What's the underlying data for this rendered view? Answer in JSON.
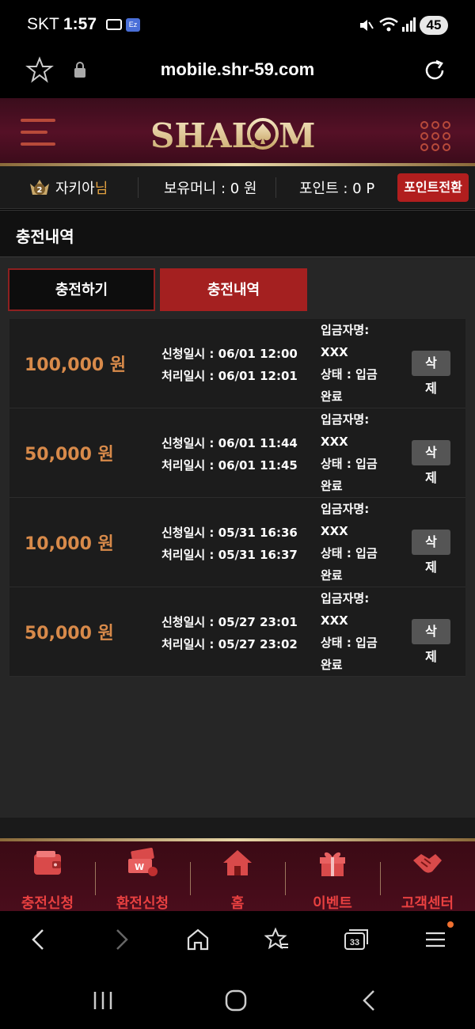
{
  "status_bar": {
    "carrier": "SKT",
    "time": "1:57",
    "battery": "45",
    "ez_label": "Ez"
  },
  "browser": {
    "url": "mobile.shr-59.com",
    "tab_count": "33"
  },
  "header": {
    "logo_text": "SHALOM"
  },
  "user_bar": {
    "level": "2",
    "username": "자키아",
    "honorific": "님",
    "money": "보유머니 : 0 원",
    "points": "포인트 : 0 P",
    "convert_label": "포인트전환"
  },
  "page": {
    "title": "충전내역"
  },
  "tabs": [
    {
      "label": "충전하기",
      "active": false
    },
    {
      "label": "충전내역",
      "active": true
    }
  ],
  "history": [
    {
      "amount": "100,000 원",
      "requested": "신청일시 : 06/01 12:00",
      "processed": "처리일시 : 06/01 12:01",
      "depositor_label": "입금자명:",
      "depositor": "XXX",
      "status_label": "상태 : 입금",
      "status_value": "완료",
      "delete_1": "삭",
      "delete_2": "제"
    },
    {
      "amount": "50,000 원",
      "requested": "신청일시 : 06/01 11:44",
      "processed": "처리일시 : 06/01 11:45",
      "depositor_label": "입금자명:",
      "depositor": "XXX",
      "status_label": "상태 : 입금",
      "status_value": "완료",
      "delete_1": "삭",
      "delete_2": "제"
    },
    {
      "amount": "10,000 원",
      "requested": "신청일시 : 05/31 16:36",
      "processed": "처리일시 : 05/31 16:37",
      "depositor_label": "입금자명:",
      "depositor": "XXX",
      "status_label": "상태 : 입금",
      "status_value": "완료",
      "delete_1": "삭",
      "delete_2": "제"
    },
    {
      "amount": "50,000 원",
      "requested": "신청일시 : 05/27 23:01",
      "processed": "처리일시 : 05/27 23:02",
      "depositor_label": "입금자명:",
      "depositor": "XXX",
      "status_label": "상태 : 입금",
      "status_value": "완료",
      "delete_1": "삭",
      "delete_2": "제"
    }
  ],
  "bottom_nav": [
    {
      "label": "충전신청",
      "icon": "wallet-icon"
    },
    {
      "label": "환전신청",
      "icon": "exchange-icon"
    },
    {
      "label": "홈",
      "icon": "home-icon"
    },
    {
      "label": "이벤트",
      "icon": "gift-icon"
    },
    {
      "label": "고객센터",
      "icon": "handshake-icon"
    }
  ],
  "colors": {
    "accent_red": "#a42020",
    "amount_orange": "#d88a4a",
    "nav_label_red": "#e84040",
    "gold": "#e6d0a0"
  }
}
